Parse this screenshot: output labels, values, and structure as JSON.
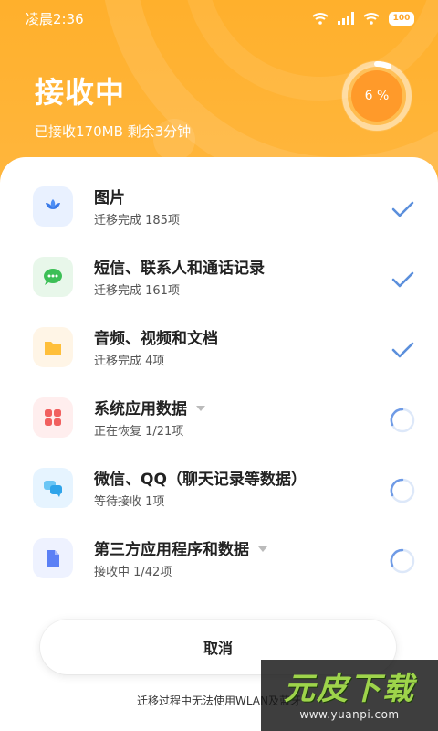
{
  "status_bar": {
    "time": "凌晨2:36",
    "battery": "100"
  },
  "header": {
    "title": "接收中",
    "subtitle": "已接收170MB 剩余3分钟",
    "progress_label": "6 %",
    "progress": 0.06
  },
  "items": [
    {
      "title": "图片",
      "subtitle": "迁移完成 185项",
      "icon": "photos-icon",
      "status": "done"
    },
    {
      "title": "短信、联系人和通话记录",
      "subtitle": "迁移完成 161项",
      "icon": "message-icon",
      "status": "done"
    },
    {
      "title": "音频、视频和文档",
      "subtitle": "迁移完成 4项",
      "icon": "folder-icon",
      "status": "done"
    },
    {
      "title": "系统应用数据",
      "subtitle": "正在恢复 1/21项",
      "icon": "apps-grid-icon",
      "status": "in-progress",
      "has_dropdown": true
    },
    {
      "title": "微信、QQ（聊天记录等数据）",
      "subtitle": "等待接收 1项",
      "icon": "chat-bubbles-icon",
      "status": "in-progress"
    },
    {
      "title": "第三方应用程序和数据",
      "subtitle": "接收中 1/42项",
      "icon": "file-icon",
      "status": "in-progress",
      "has_dropdown": true
    }
  ],
  "cancel_label": "取消",
  "footer_note": "迁移过程中无法使用WLAN及蓝牙",
  "watermark": {
    "title": "元皮下载",
    "url": "www.yuanpi.com"
  },
  "colors": {
    "accent": "#ffb02c",
    "check": "#5b8fdc",
    "spinner": "#6f9be6"
  }
}
